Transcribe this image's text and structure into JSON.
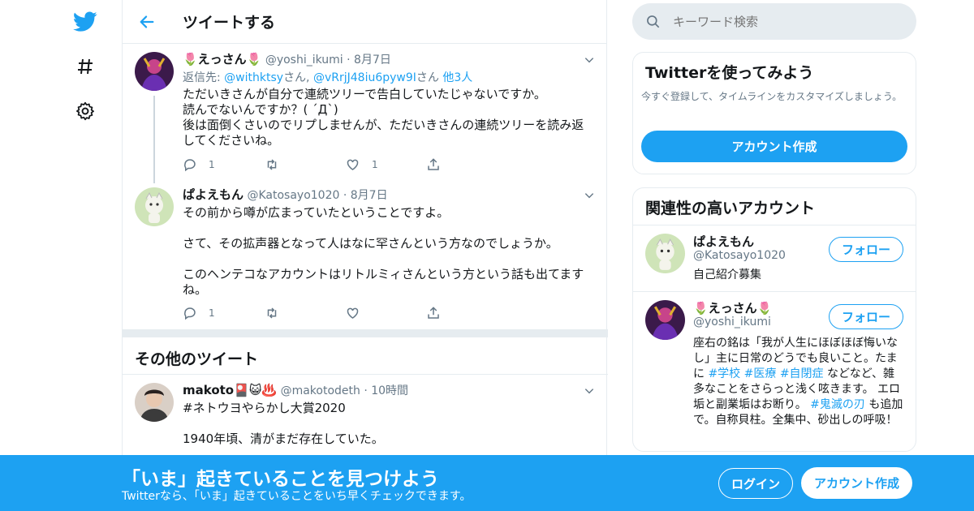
{
  "nav": {
    "icons": [
      "twitter-logo",
      "hashtag",
      "settings"
    ]
  },
  "header": {
    "title": "ツイートする"
  },
  "tweets": [
    {
      "name": "🌷えっさん🌷",
      "handle": "@yoshi_ikumi",
      "time": "8月7日",
      "reply_prefix": "返信先: ",
      "reply_users": [
        "@withktsy",
        "@vRrjJ48iu6pyw9I"
      ],
      "reply_sep": "さん, ",
      "reply_suffix": "さん ",
      "reply_others": "他3人",
      "text": "ただいきさんが自分で連続ツリーで告白していたじゃないですか。\n読んでないんですか？( ´Д`)\n後は面倒くさいのでリプしませんが、ただいきさんの連続ツリーを読み返してくださいね。",
      "reply_count": "1",
      "retweet_count": "",
      "like_count": "1"
    },
    {
      "name": "ぱよえもん",
      "handle": "@Katosayo1020",
      "time": "8月7日",
      "text": "その前から噂が広まっていたということですよ。\n\nさて、その拡声器となって人はなに罕さんという方なのでしょうか。\n\nこのヘンテコなアカウントはリトルミィさんという方という話も出てますね。",
      "reply_count": "1",
      "retweet_count": "",
      "like_count": ""
    }
  ],
  "more_section": {
    "title": "その他のツイート"
  },
  "more_tweet": {
    "name": "makoto🎴😺♨️",
    "handle": "@makotodeth",
    "time": "10時間",
    "hashtag": "#ネトウヨやらかし大賞2020",
    "text": "1940年頃、清がまだ存在していた。"
  },
  "search": {
    "placeholder": "キーワード検索"
  },
  "signup_card": {
    "title": "Twitterを使ってみよう",
    "desc": "今すぐ登録して、タイムラインをカスタマイズしましょう。",
    "button": "アカウント作成"
  },
  "related": {
    "title": "関連性の高いアカウント",
    "follow_label": "フォロー",
    "accounts": [
      {
        "name": "ぱよえもん",
        "handle": "@Katosayo1020",
        "bio": "自己紹介募集"
      },
      {
        "name": "🌷えっさん🌷",
        "handle": "@yoshi_ikumi",
        "bio_parts": [
          "座右の銘は「我が人生にほぼほぼ悔いなし」主に日常のどうでも良いこと。たまに ",
          "#学校",
          " ",
          "#医療",
          " ",
          "#自閉症",
          " などなど、雑多なことをさらっと浅く呟きます。 エロ垢と副業垢はお断り。 ",
          "#鬼滅の刃",
          " も追加で。自称貝柱。全集中、砂出しの呼吸！"
        ]
      }
    ]
  },
  "banner": {
    "title": "「いま」起きていることを見つけよう",
    "subtitle": "Twitterなら、「いま」起きていることをいち早くチェックできます。",
    "login": "ログイン",
    "signup": "アカウント作成"
  },
  "colors": {
    "accent": "#1da1f2",
    "muted": "#657786",
    "border": "#e6ecf0"
  }
}
